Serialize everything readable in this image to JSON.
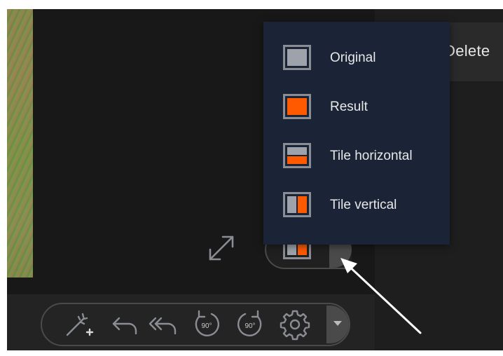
{
  "right_panel": {
    "delete_label": "Delete"
  },
  "view_menu": {
    "items": [
      {
        "label": "Original",
        "icon": "view-original-icon"
      },
      {
        "label": "Result",
        "icon": "view-result-icon"
      },
      {
        "label": "Tile horizontal",
        "icon": "view-tile-horizontal-icon"
      },
      {
        "label": "Tile vertical",
        "icon": "view-tile-vertical-icon"
      }
    ]
  },
  "view_toggle": {
    "current_icon": "view-tile-vertical-icon"
  },
  "toolbar": {
    "icons": [
      "magic-wand-icon",
      "undo-icon",
      "undo-all-icon",
      "rotate-left-90-icon",
      "rotate-right-90-icon",
      "settings-gear-icon"
    ],
    "rotate_left_text": "90°",
    "rotate_right_text": "90°"
  },
  "colors": {
    "accent": "#ff5a00",
    "menu_bg": "#1a2436",
    "icon_gray": "#8a8d93",
    "canvas_bg": "#181818"
  }
}
